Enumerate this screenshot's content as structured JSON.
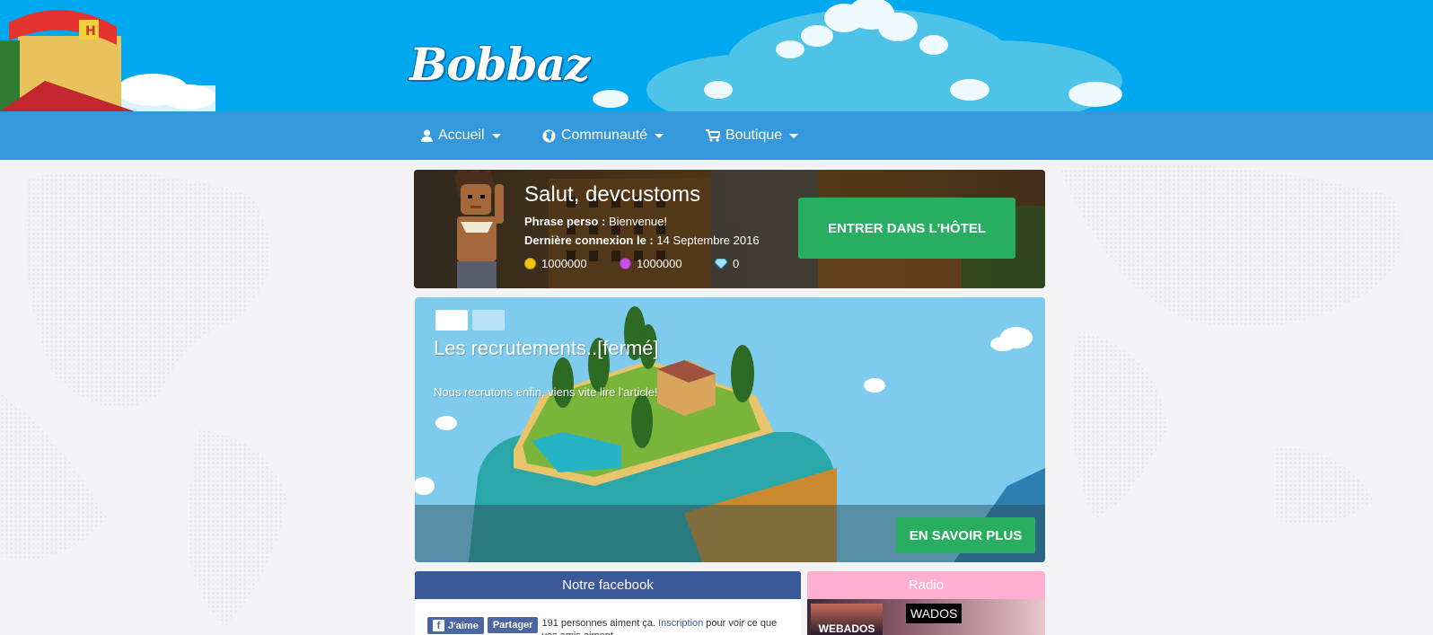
{
  "site": {
    "logo_text": "Bobbaz"
  },
  "nav": {
    "items": [
      {
        "label": "Accueil",
        "icon": "user-icon"
      },
      {
        "label": "Communauté",
        "icon": "globe-icon"
      },
      {
        "label": "Boutique",
        "icon": "cart-icon"
      }
    ]
  },
  "welcome": {
    "greeting": "Salut, devcustoms",
    "motto_label": "Phrase perso :",
    "motto_value": " Bienvenue!",
    "last_login_label": "Dernière connexion le :",
    "last_login_value": " 14 Septembre 2016",
    "credits": "1000000",
    "duckets": "1000000",
    "diamonds": "0",
    "enter_button": "ENTRER DANS L'HÔTEL"
  },
  "news": {
    "title": "Les recrutements..[fermé]",
    "summary": "Nous recrutons enfin, viens vite lire l'article!",
    "more_button": "EN SAVOIR PLUS"
  },
  "facebook": {
    "title": "Notre facebook",
    "like_button": "J'aime",
    "share_button": "Partager",
    "text_before": "191 personnes aiment ça.",
    "link": "Inscription",
    "text_after": " pour voir ce que vos amis aiment."
  },
  "radio": {
    "title": "Radio",
    "station": "WADOS",
    "logo_text": "WEBADOS"
  },
  "colors": {
    "banner": "#00a8f0",
    "nav": "#3498db",
    "green": "#27ae60",
    "facebook": "#3b5998",
    "radio": "#ffb0d0"
  }
}
